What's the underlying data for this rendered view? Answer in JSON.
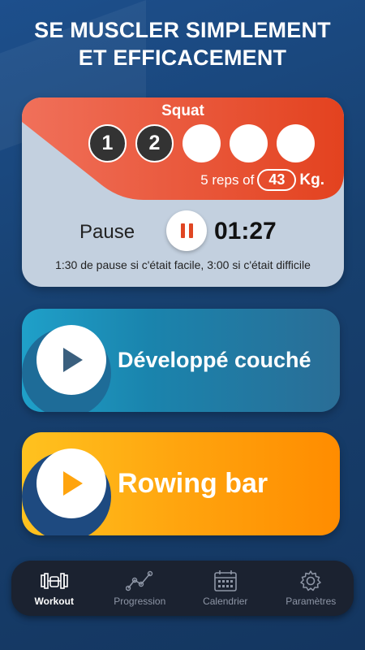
{
  "headline": {
    "line1": "SE MUSCLER SIMPLEMENT",
    "line2": "ET EFFICACEMENT"
  },
  "current_exercise": {
    "name": "Squat",
    "sets": [
      {
        "label": "1",
        "done": true
      },
      {
        "label": "2",
        "done": true
      },
      {
        "label": "",
        "done": false
      },
      {
        "label": "",
        "done": false
      },
      {
        "label": "",
        "done": false
      }
    ],
    "reps_text": "5 reps of",
    "weight": "43",
    "unit": "Kg.",
    "pause_label": "Pause",
    "timer": "01:27",
    "pause_hint": "1:30 de pause si c'était facile, 3:00 si c'était difficile",
    "accent": "#e8512e"
  },
  "exercises": [
    {
      "name": "Développé couché",
      "color": "#1fa0c9"
    },
    {
      "name": "Rowing bar",
      "color": "#ffa40e"
    }
  ],
  "nav": {
    "items": [
      {
        "label": "Workout",
        "icon": "workout-icon",
        "active": true
      },
      {
        "label": "Progression",
        "icon": "progression-icon",
        "active": false
      },
      {
        "label": "Calendrier",
        "icon": "calendar-icon",
        "active": false
      },
      {
        "label": "Paramètres",
        "icon": "gear-icon",
        "active": false
      }
    ]
  }
}
